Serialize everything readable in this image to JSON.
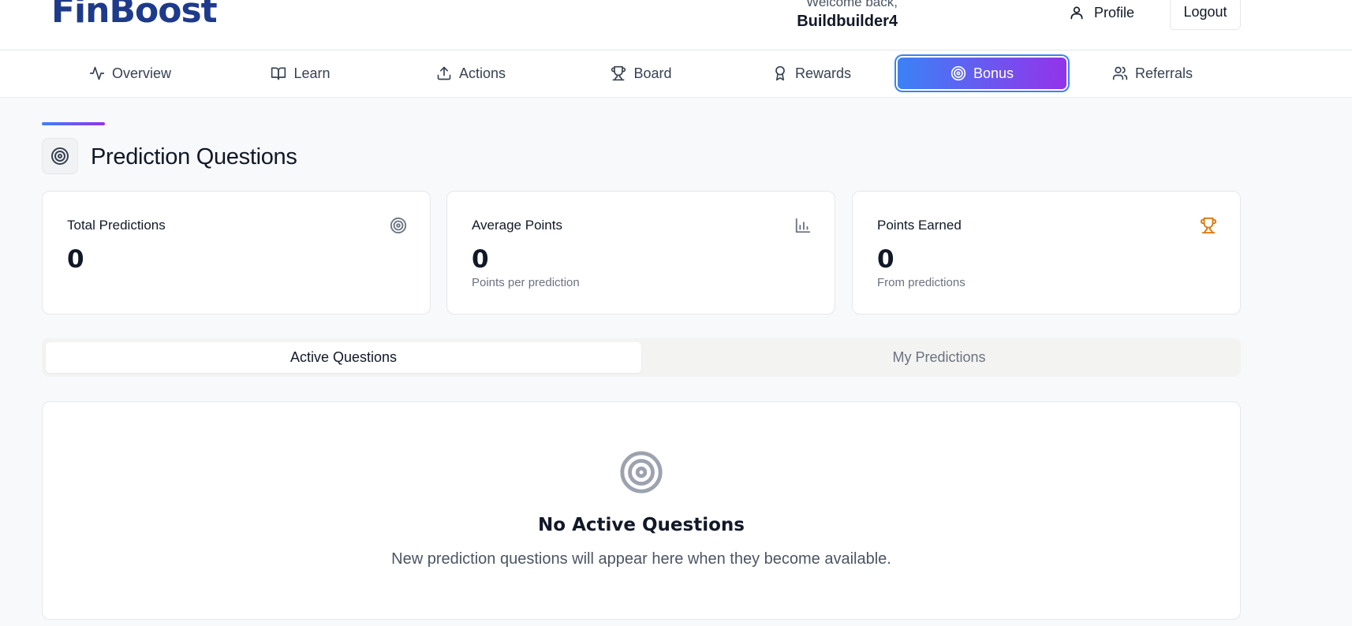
{
  "header": {
    "logo": "FinBoost",
    "welcome_line": "Welcome back,",
    "username": "Buildbuilder4",
    "profile_label": "Profile",
    "logout_label": "Logout"
  },
  "nav": {
    "items": [
      {
        "label": "Overview",
        "icon": "activity-icon"
      },
      {
        "label": "Learn",
        "icon": "book-icon"
      },
      {
        "label": "Actions",
        "icon": "upload-icon"
      },
      {
        "label": "Board",
        "icon": "trophy-icon"
      },
      {
        "label": "Rewards",
        "icon": "award-icon"
      },
      {
        "label": "Bonus",
        "icon": "target-icon",
        "active": true
      },
      {
        "label": "Referrals",
        "icon": "users-icon"
      }
    ]
  },
  "page": {
    "title": "Prediction Questions",
    "title_icon": "target-icon"
  },
  "stats": [
    {
      "label": "Total Predictions",
      "value": "0",
      "sub": "",
      "icon": "target-icon"
    },
    {
      "label": "Average Points",
      "value": "0",
      "sub": "Points per prediction",
      "icon": "bar-chart-icon"
    },
    {
      "label": "Points Earned",
      "value": "0",
      "sub": "From predictions",
      "icon": "trophy-icon"
    }
  ],
  "tabs": {
    "active": "Active Questions",
    "inactive": "My Predictions"
  },
  "empty_state": {
    "title": "No Active Questions",
    "description": "New prediction questions will appear here when they become available."
  },
  "colors": {
    "brand": "#1e3a8a",
    "accent_start": "#3b82f6",
    "accent_end": "#9333ea",
    "trophy": "#d97706"
  }
}
